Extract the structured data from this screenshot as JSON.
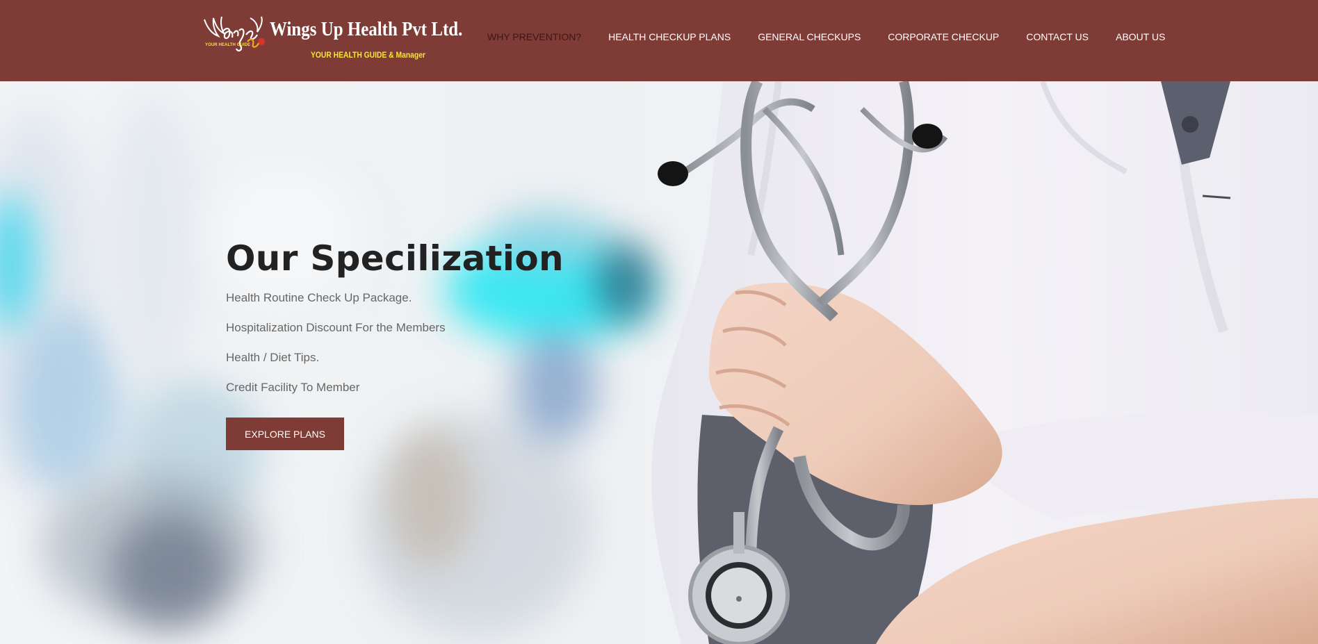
{
  "brand": {
    "name": "Wings Up Health Pvt Ltd.",
    "tagline": "YOUR HEALTH GUIDE & Manager",
    "mark_text": "YOUR HEALTH GUIDE",
    "colors": {
      "primary": "#7f3b36",
      "tagline": "#f5e63a"
    }
  },
  "nav": {
    "items": [
      {
        "label": "WHY PREVENTION?",
        "active": true
      },
      {
        "label": "HEALTH CHECKUP PLANS"
      },
      {
        "label": "GENERAL CHECKUPS"
      },
      {
        "label": "CORPORATE CHECKUP"
      },
      {
        "label": "CONTACT US"
      },
      {
        "label": "ABOUT US"
      }
    ]
  },
  "hero": {
    "title": "Our Specilization",
    "items": [
      "Health Routine Check Up Package.",
      "Hospitalization Discount For the Members",
      "Health / Diet Tips.",
      "Credit Facility To Member"
    ],
    "button_label": "EXPLORE PLANS"
  }
}
